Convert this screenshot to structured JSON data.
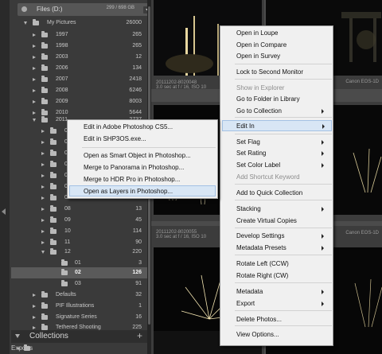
{
  "folders_panel": {
    "volume_name": "Files (D:)",
    "volume_size": "299 / 698 GB",
    "tree": [
      {
        "label": "My Pictures",
        "count": "26000",
        "expanded": true
      },
      {
        "label": "1997",
        "count": "265"
      },
      {
        "label": "1998",
        "count": "265"
      },
      {
        "label": "2003",
        "count": "12"
      },
      {
        "label": "2006",
        "count": "134"
      },
      {
        "label": "2007",
        "count": "2418"
      },
      {
        "label": "2008",
        "count": "6246"
      },
      {
        "label": "2009",
        "count": "8003"
      },
      {
        "label": "2010",
        "count": "5644"
      },
      {
        "label": "2011",
        "count": "2737",
        "expanded": true
      },
      {
        "label": "01",
        "count": ""
      },
      {
        "label": "02",
        "count": ""
      },
      {
        "label": "03",
        "count": ""
      },
      {
        "label": "04",
        "count": ""
      },
      {
        "label": "05",
        "count": ""
      },
      {
        "label": "06",
        "count": ""
      },
      {
        "label": "07",
        "count": ""
      },
      {
        "label": "08",
        "count": "13"
      },
      {
        "label": "09",
        "count": "45"
      },
      {
        "label": "10",
        "count": "114"
      },
      {
        "label": "11",
        "count": "90"
      },
      {
        "label": "12",
        "count": "220",
        "expanded": true
      },
      {
        "label": "01",
        "count": "3"
      },
      {
        "label": "02",
        "count": "126",
        "selected": true
      },
      {
        "label": "03",
        "count": "91"
      },
      {
        "label": "Defaults",
        "count": "32"
      },
      {
        "label": "PIF Illustrations",
        "count": "1"
      },
      {
        "label": "Signature Series",
        "count": "16"
      },
      {
        "label": "Tethered Shooting",
        "count": "225"
      }
    ]
  },
  "collections": {
    "label": "Collections",
    "add_symbol": "+",
    "first_item": "Exports"
  },
  "grid": {
    "cells": [
      {
        "filename": "20111202-8020048",
        "exposure": "3.0 sec at f / 16, ISO 10",
        "camera": "Canon EOS-1D"
      },
      {
        "filename": "20111202-8020055",
        "exposure": "3.0 sec at f / 16, ISO 10",
        "camera": "Canon EOS-1D"
      }
    ]
  },
  "context_menu": {
    "items": [
      {
        "label": "Open in Loupe"
      },
      {
        "label": "Open in Compare"
      },
      {
        "label": "Open in Survey"
      },
      {
        "label": "Lock to Second Monitor"
      },
      {
        "label": "Show in Explorer",
        "disabled": true
      },
      {
        "label": "Go to Folder in Library"
      },
      {
        "label": "Go to Collection",
        "submenu": true
      },
      {
        "label": "Edit In",
        "submenu": true,
        "highlighted": true
      },
      {
        "label": "Set Flag",
        "submenu": true
      },
      {
        "label": "Set Rating",
        "submenu": true
      },
      {
        "label": "Set Color Label",
        "submenu": true
      },
      {
        "label": "Add Shortcut Keyword",
        "disabled": true
      },
      {
        "label": "Add to Quick Collection"
      },
      {
        "label": "Stacking",
        "submenu": true
      },
      {
        "label": "Create Virtual Copies"
      },
      {
        "label": "Develop Settings",
        "submenu": true
      },
      {
        "label": "Metadata Presets",
        "submenu": true
      },
      {
        "label": "Rotate Left (CCW)"
      },
      {
        "label": "Rotate Right (CW)"
      },
      {
        "label": "Metadata",
        "submenu": true
      },
      {
        "label": "Export",
        "submenu": true
      },
      {
        "label": "Delete Photos..."
      },
      {
        "label": "View Options..."
      }
    ]
  },
  "edit_in_submenu": {
    "items": [
      {
        "label": "Edit in Adobe Photoshop CS5..."
      },
      {
        "label": "Edit in SHP3OS.exe..."
      },
      {
        "label": "Open as Smart Object in Photoshop..."
      },
      {
        "label": "Merge to Panorama in Photoshop..."
      },
      {
        "label": "Merge to HDR Pro in Photoshop..."
      },
      {
        "label": "Open as Layers in Photoshop...",
        "highlighted": true
      }
    ]
  },
  "colors": {
    "panel_bg": "#3a3a3a",
    "selected_row": "#5a5a5a",
    "menu_bg": "#f0f0f0",
    "menu_highlight": "#d8e6f5"
  }
}
